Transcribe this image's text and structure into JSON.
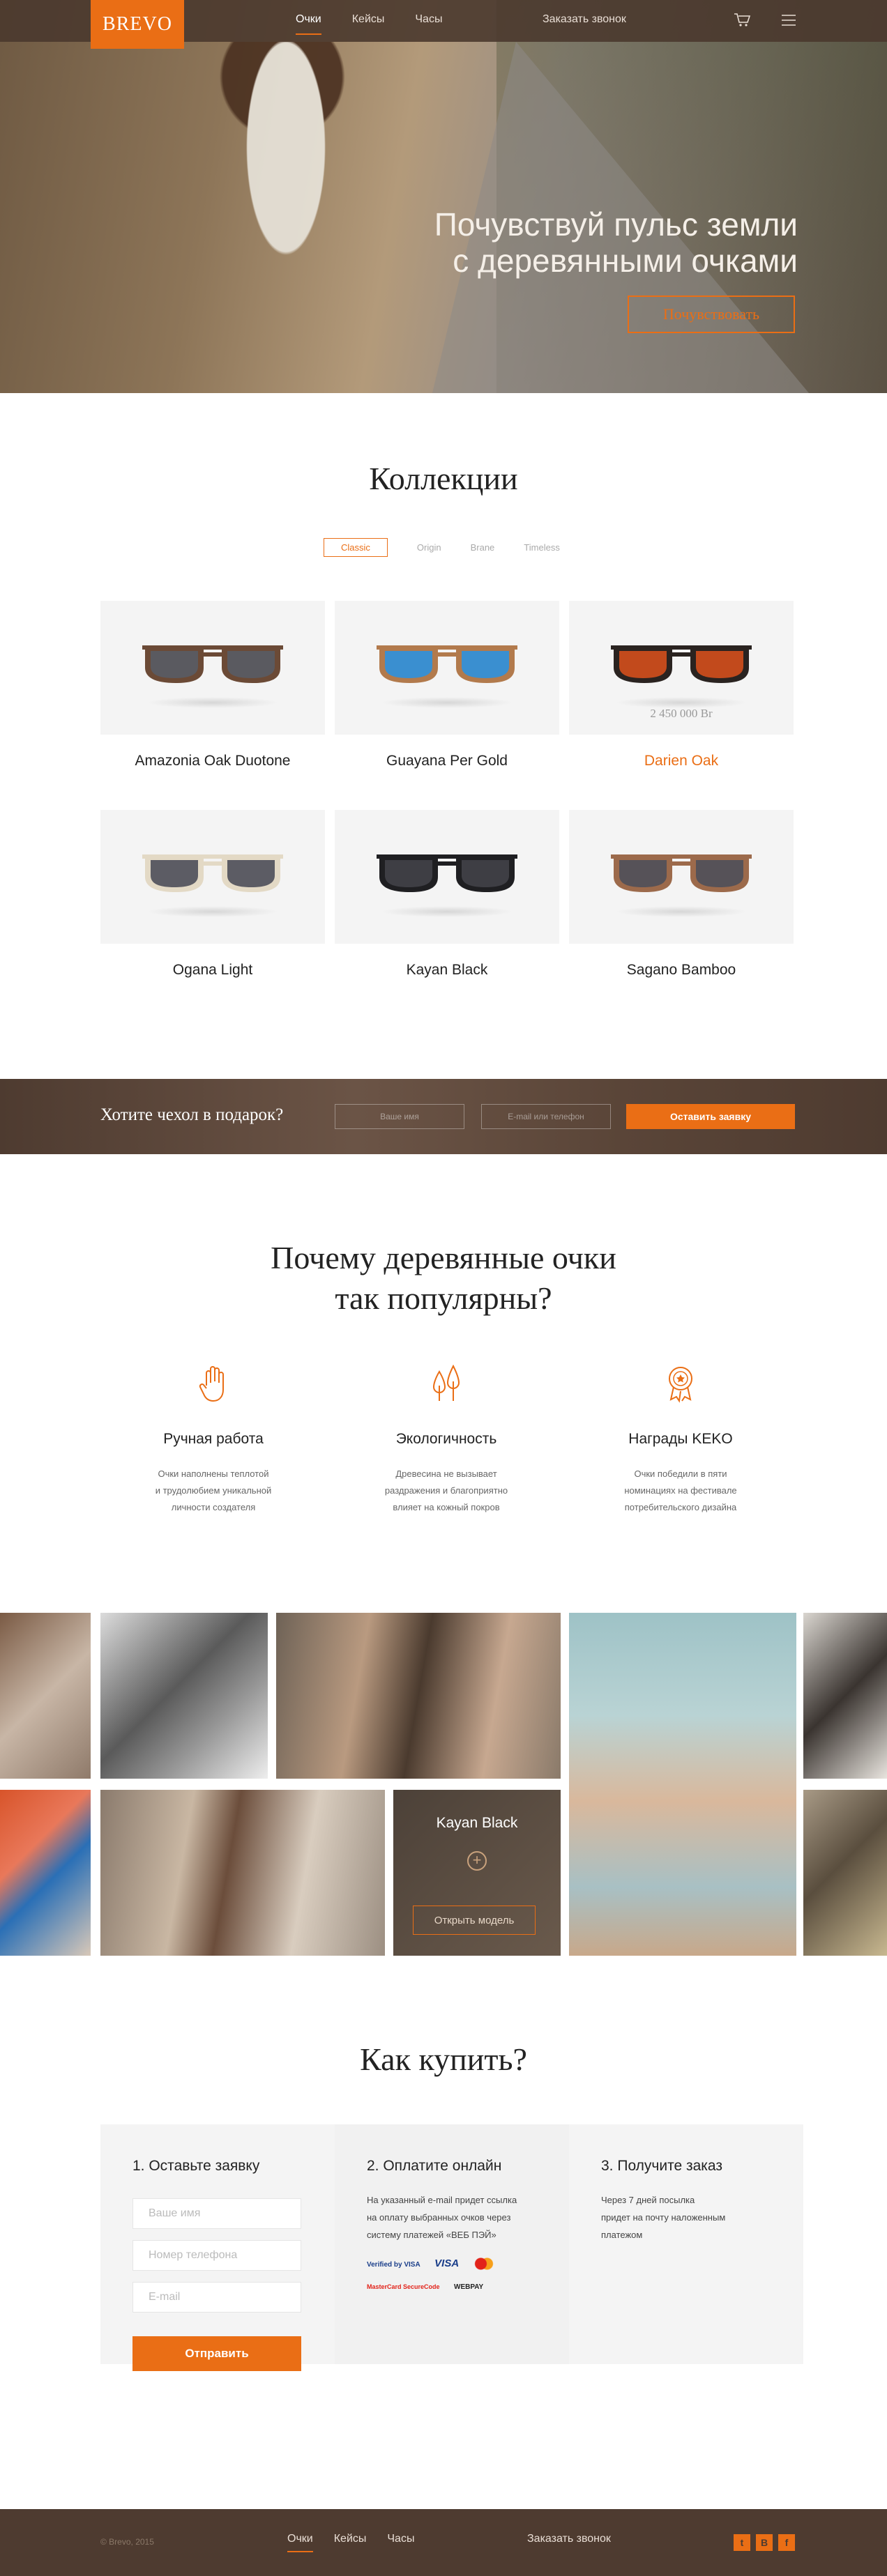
{
  "brand": {
    "logo": "BREVO",
    "accent": "#ea6e15",
    "dark": "#4e3b30"
  },
  "nav": {
    "links": [
      "Очки",
      "Кейсы",
      "Часы"
    ],
    "active": "Очки",
    "call": "Заказать звонок",
    "icons": [
      "cart-icon",
      "menu-icon"
    ]
  },
  "hero": {
    "title_line1": "Почувствуй пульс земли",
    "title_line2": "с деревянными очками",
    "button": "Почувствовать"
  },
  "collections": {
    "title": "Коллекции",
    "tabs": [
      "Classic",
      "Origin",
      "Brane",
      "Timeless"
    ],
    "active_tab": "Classic",
    "products": [
      {
        "name": "Amazonia Oak Duotone",
        "frame": "#6b4a36",
        "lens": "#5a5a60"
      },
      {
        "name": "Guayana Per Gold",
        "frame": "#b27a4c",
        "lens": "#3a8fd0"
      },
      {
        "name": "Darien Oak",
        "frame": "#2a2320",
        "lens": "#c24a1c",
        "price": "2 450 000 Br",
        "highlighted": true
      },
      {
        "name": "Ogana Light",
        "frame": "#e3d9c5",
        "lens": "#5c5c64"
      },
      {
        "name": "Kayan Black",
        "frame": "#1f1f22",
        "lens": "#3e3e44"
      },
      {
        "name": "Sagano Bamboo",
        "frame": "#9c6a4b",
        "lens": "#565258"
      }
    ]
  },
  "promo": {
    "question": "Хотите чехол в подарок?",
    "name_placeholder": "Ваше имя",
    "contact_placeholder": "E-mail или телефон",
    "submit": "Оставить заявку"
  },
  "why": {
    "title_line1": "Почему деревянные очки",
    "title_line2": "так популярны?",
    "features": [
      {
        "icon": "hand-icon",
        "title": "Ручная работа",
        "text_lines": [
          "Очки наполнены теплотой",
          "и трудолюбием уникальной",
          "личности создателя"
        ]
      },
      {
        "icon": "trees-icon",
        "title": "Экологичность",
        "text_lines": [
          "Древесина не вызывает",
          "раздражения и благоприятно",
          "влияет на кожный покров"
        ]
      },
      {
        "icon": "award-icon",
        "title": "Награды KEKO",
        "text_lines": [
          "Очки победили в пяти",
          "номинациях на фестивале",
          "потребительского дизайна"
        ]
      }
    ]
  },
  "gallery": {
    "model_title": "Kayan Black",
    "model_button": "Открыть модель"
  },
  "buy": {
    "title": "Как купить?",
    "step1": {
      "title": "1. Оставьте заявку",
      "name": "Ваше имя",
      "phone": "Номер телефона",
      "email": "E-mail",
      "submit": "Отправить"
    },
    "step2": {
      "title": "2. Оплатите онлайн",
      "text_lines": [
        "На указанный e-mail придет ссылка",
        "на оплату выбранных очков через",
        "систему платежей «ВЕБ ПЭЙ»"
      ],
      "payments": [
        "Verified by VISA",
        "VISA",
        "MasterCard",
        "MasterCard SecureCode",
        "WEBPAY"
      ]
    },
    "step3": {
      "title": "3. Получите заказ",
      "text_lines": [
        "Через 7 дней посылка",
        "придет на почту наложенным",
        "платежом"
      ]
    }
  },
  "footer": {
    "copyright": "© Brevo, 2015",
    "links": [
      "Очки",
      "Кейсы",
      "Часы"
    ],
    "active": "Очки",
    "call": "Заказать звонок",
    "social": [
      "twitter-icon",
      "vk-icon",
      "facebook-icon"
    ]
  }
}
